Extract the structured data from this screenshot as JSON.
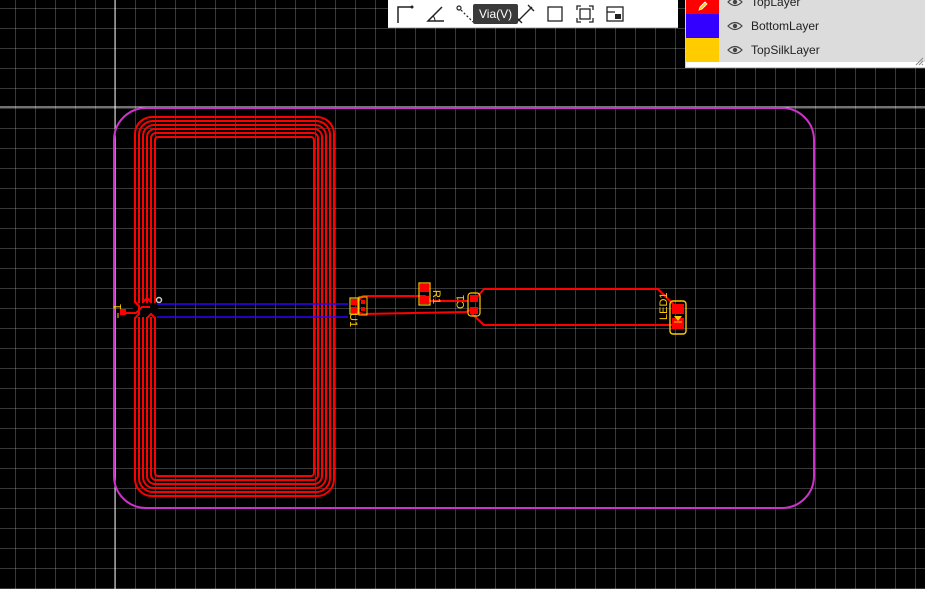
{
  "colors": {
    "background": "#000000",
    "grid": "#ffffff",
    "board_outline": "#cc33cc",
    "top_layer": "#ff0000",
    "bottom_layer": "#3300ff",
    "top_silk_layer": "#ffcc00"
  },
  "toolbar": {
    "tools": [
      {
        "name": "track-icon"
      },
      {
        "name": "arc-icon"
      },
      {
        "name": "via-icon"
      },
      {
        "name": "pad-icon"
      },
      {
        "name": "dimension-icon"
      },
      {
        "name": "rectangle-icon"
      },
      {
        "name": "copper-area-icon"
      },
      {
        "name": "image-icon"
      }
    ],
    "tooltip": "Via(V)"
  },
  "layers": [
    {
      "name": "TopLayer",
      "color": "#ff0000",
      "icon": "pencil-icon",
      "visible": true
    },
    {
      "name": "BottomLayer",
      "color": "#3300ff",
      "visible": true
    },
    {
      "name": "TopSilkLayer",
      "color": "#ffcc00",
      "visible": true
    }
  ],
  "designators": {
    "coil_pin": "1",
    "u1": "U1",
    "r1": "R1",
    "c1": "C1",
    "led1": "LED1"
  }
}
